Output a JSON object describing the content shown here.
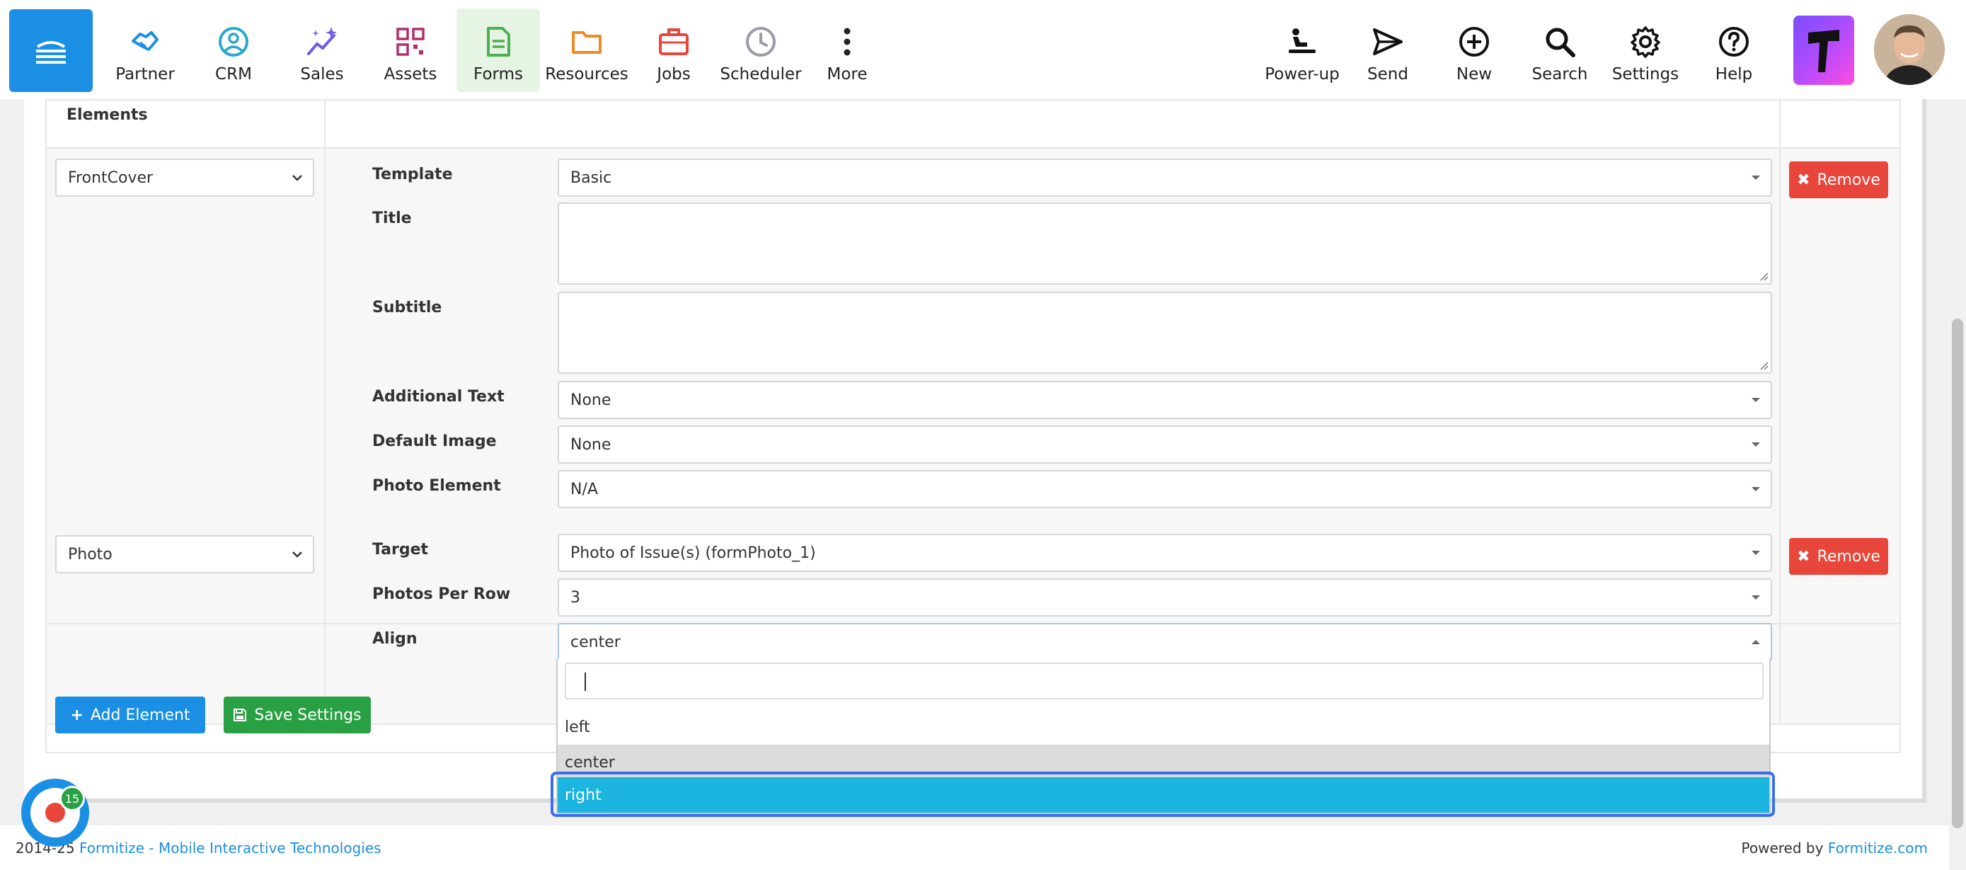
{
  "nav": {
    "items": [
      {
        "label": "Partner",
        "icon": "handshake-icon",
        "color": "#1a8fe3"
      },
      {
        "label": "CRM",
        "icon": "user-circle-icon",
        "color": "#2aa9c9"
      },
      {
        "label": "Sales",
        "icon": "sparkle-chart-icon",
        "color": "#6b5ce7"
      },
      {
        "label": "Assets",
        "icon": "qr-code-icon",
        "color": "#b0306b"
      },
      {
        "label": "Forms",
        "icon": "document-icon",
        "color": "#4caf50"
      },
      {
        "label": "Resources",
        "icon": "folder-icon",
        "color": "#f08a24"
      },
      {
        "label": "Jobs",
        "icon": "briefcase-icon",
        "color": "#e8463a"
      },
      {
        "label": "Scheduler",
        "icon": "clock-icon",
        "color": "#9a9aa8"
      },
      {
        "label": "More",
        "icon": "more-vertical-icon",
        "color": "#222222"
      }
    ],
    "right_items": [
      {
        "label": "Power-up",
        "icon": "power-up-icon"
      },
      {
        "label": "Send",
        "icon": "send-icon"
      },
      {
        "label": "New",
        "icon": "plus-circle-icon"
      },
      {
        "label": "Search",
        "icon": "search-icon"
      },
      {
        "label": "Settings",
        "icon": "gear-icon"
      },
      {
        "label": "Help",
        "icon": "help-icon"
      }
    ]
  },
  "table": {
    "header": "Elements",
    "rows": [
      {
        "type": "FrontCover",
        "fields": [
          {
            "label": "Template",
            "kind": "select",
            "value": "Basic"
          },
          {
            "label": "Title",
            "kind": "textarea",
            "value": ""
          },
          {
            "label": "Subtitle",
            "kind": "textarea",
            "value": ""
          },
          {
            "label": "Additional Text",
            "kind": "select",
            "value": "None"
          },
          {
            "label": "Default Image",
            "kind": "select",
            "value": "None"
          },
          {
            "label": "Photo Element",
            "kind": "select",
            "value": "N/A"
          }
        ],
        "remove_label": "Remove"
      },
      {
        "type": "Photo",
        "fields": [
          {
            "label": "Target",
            "kind": "select",
            "value": "Photo of Issue(s) (formPhoto_1)"
          },
          {
            "label": "Photos Per Row",
            "kind": "select",
            "value": "3"
          },
          {
            "label": "Align",
            "kind": "select",
            "value": "center"
          }
        ],
        "remove_label": "Remove"
      }
    ]
  },
  "buttons": {
    "add_element": "Add Element",
    "save_settings": "Save Settings"
  },
  "dropdown": {
    "search_value": "",
    "options": [
      "left",
      "center",
      "right"
    ],
    "hover_option": "center",
    "highlighted_option": "right"
  },
  "footer": {
    "copyright_prefix": "2014-25",
    "company_link": "Formitize - Mobile Interactive Technologies",
    "powered_prefix": "Powered by",
    "powered_link": "Formitize.com"
  },
  "chat": {
    "badge_count": "15"
  },
  "colors": {
    "primary": "#1a8fe3",
    "success": "#2aa045",
    "danger": "#e8463a",
    "dropdown_highlight": "#1bb5e0",
    "forms_active_bg": "#e6f4e3"
  }
}
